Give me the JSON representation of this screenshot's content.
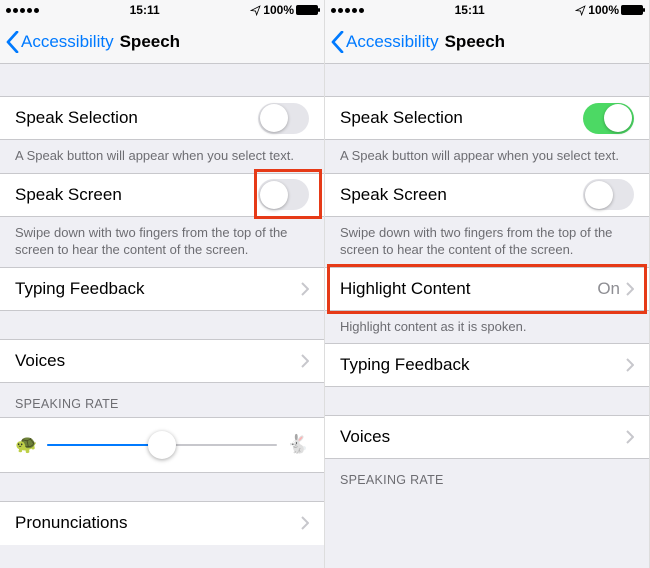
{
  "status": {
    "time": "15:11",
    "battery_pct": "100%"
  },
  "nav": {
    "back_label": "Accessibility",
    "title": "Speech"
  },
  "left": {
    "speak_selection": {
      "label": "Speak Selection",
      "on": false
    },
    "speak_selection_footer": "A Speak button will appear when you select text.",
    "speak_screen": {
      "label": "Speak Screen",
      "on": false
    },
    "speak_screen_footer": "Swipe down with two fingers from the top of the screen to hear the content of the screen.",
    "typing_feedback": {
      "label": "Typing Feedback"
    },
    "voices": {
      "label": "Voices"
    },
    "speaking_rate_header": "SPEAKING RATE",
    "speaking_rate_value": 0.5,
    "pronunciations": {
      "label": "Pronunciations"
    }
  },
  "right": {
    "speak_selection": {
      "label": "Speak Selection",
      "on": true
    },
    "speak_selection_footer": "A Speak button will appear when you select text.",
    "speak_screen": {
      "label": "Speak Screen",
      "on": false
    },
    "speak_screen_footer": "Swipe down with two fingers from the top of the screen to hear the content of the screen.",
    "highlight_content": {
      "label": "Highlight Content",
      "value": "On"
    },
    "highlight_content_footer": "Highlight content as it is spoken.",
    "typing_feedback": {
      "label": "Typing Feedback"
    },
    "voices": {
      "label": "Voices"
    },
    "speaking_rate_header": "SPEAKING RATE"
  }
}
